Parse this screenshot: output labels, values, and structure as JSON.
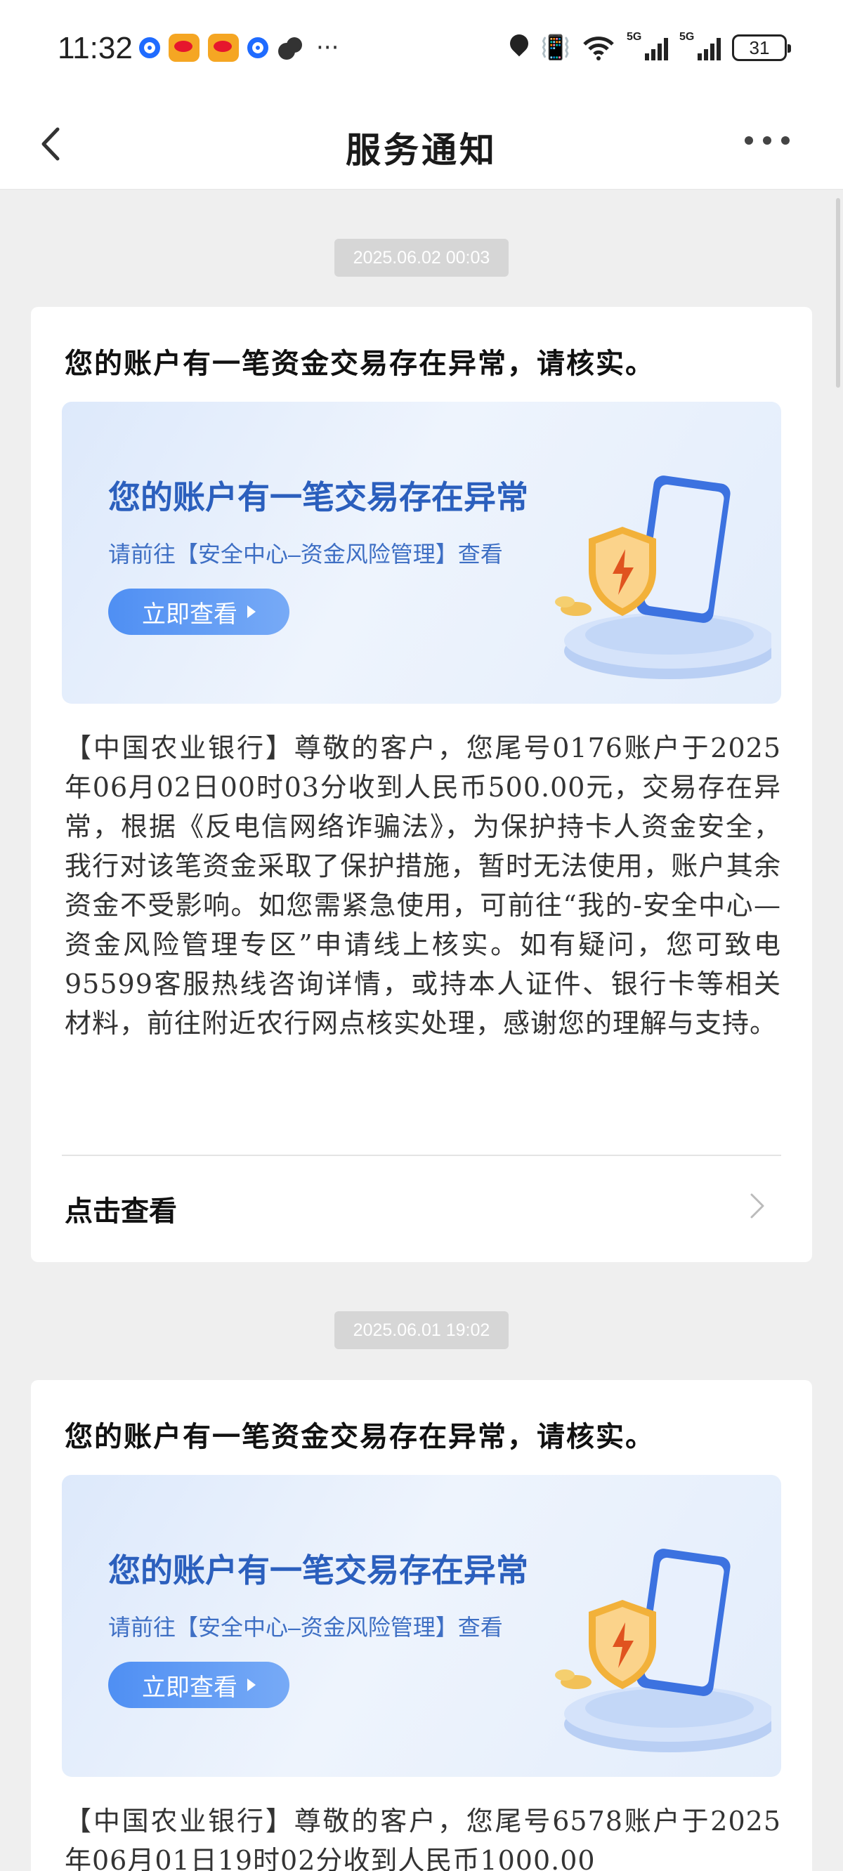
{
  "status_bar": {
    "time": "11:32",
    "more": "···",
    "battery": "31",
    "network_1": "5G",
    "network_2": "5G"
  },
  "nav": {
    "title": "服务通知"
  },
  "notifications": [
    {
      "timestamp": "2025.06.02 00:03",
      "title": "您的账户有一笔资金交易存在异常，请核实。",
      "banner_heading": "您的账户有一笔交易存在异常",
      "banner_sub": "请前往【安全中心–资金风险管理】查看",
      "banner_button": "立即查看",
      "body": "【中国农业银行】尊敬的客户，您尾号0176账户于2025年06月02日00时03分收到人民币500.00元，交易存在异常，根据《反电信网络诈骗法》，为保护持卡人资金安全，我行对该笔资金采取了保护措施，暂时无法使用，账户其余资金不受影响。如您需紧急使用，可前往“我的-安全中心—资金风险管理专区”申请线上核实。如有疑问，您可致电95599客服热线咨询详情，或持本人证件、银行卡等相关材料，前往附近农行网点核实处理，感谢您的理解与支持。",
      "link": "点击查看"
    },
    {
      "timestamp": "2025.06.01 19:02",
      "title": "您的账户有一笔资金交易存在异常，请核实。",
      "banner_heading": "您的账户有一笔交易存在异常",
      "banner_sub": "请前往【安全中心–资金风险管理】查看",
      "banner_button": "立即查看",
      "body": "【中国农业银行】尊敬的客户，您尾号6578账户于2025年06月01日19时02分收到人民币1000.00"
    }
  ],
  "colors": {
    "accent": "#4f8ff3",
    "banner_text": "#2b5fbd",
    "background": "#efefef"
  }
}
